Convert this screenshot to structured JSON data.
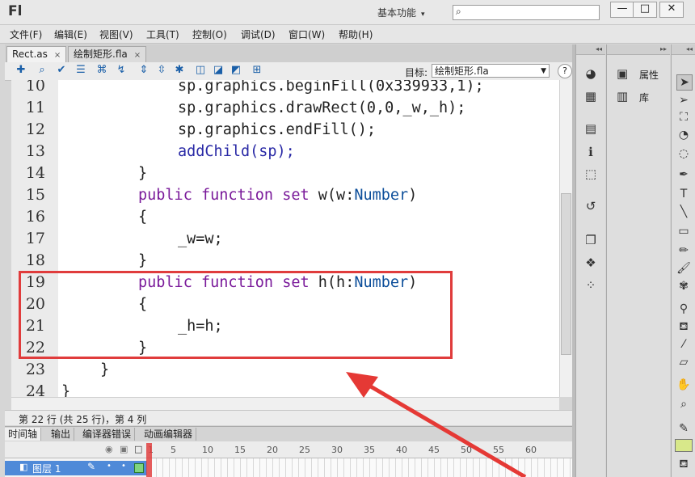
{
  "app": {
    "logo": "Fl",
    "workspace": "基本功能",
    "search_placeholder": ""
  },
  "window_controls": {
    "minimize": "—",
    "restore": "□",
    "close": "✕"
  },
  "menu": [
    "文件(F)",
    "编辑(E)",
    "视图(V)",
    "工具(T)",
    "控制(O)",
    "调试(D)",
    "窗口(W)",
    "帮助(H)"
  ],
  "tabs": [
    {
      "label": "Rect.as",
      "close": "×"
    },
    {
      "label": "绘制矩形.fla",
      "close": "×"
    }
  ],
  "toolbar": {
    "target_label": "目标:",
    "target_value": "绘制矩形.fla",
    "help": "?"
  },
  "editor": {
    "lines": [
      {
        "num": "10",
        "indent": 6
      },
      {
        "num": "11",
        "indent": 6
      },
      {
        "num": "12",
        "indent": 6
      },
      {
        "num": "13",
        "indent": 6
      },
      {
        "num": "14",
        "indent": 4
      },
      {
        "num": "15",
        "indent": 4
      },
      {
        "num": "16",
        "indent": 4
      },
      {
        "num": "17",
        "indent": 6
      },
      {
        "num": "18",
        "indent": 4
      },
      {
        "num": "19",
        "indent": 4
      },
      {
        "num": "20",
        "indent": 4
      },
      {
        "num": "21",
        "indent": 6
      },
      {
        "num": "22",
        "indent": 4
      },
      {
        "num": "23",
        "indent": 2
      },
      {
        "num": "24",
        "indent": 0
      }
    ],
    "code": {
      "l10": "sp.graphics.beginFill(0x339933,1);",
      "l11": "sp.graphics.drawRect(0,0,_w,_h);",
      "l12": "sp.graphics.endFill();",
      "l13": "addChild(sp);",
      "l14": "}",
      "l15_kw1": "public",
      "l15_kw2": "function",
      "l15_kw3": "set",
      "l15_name": "w(w:",
      "l15_type": "Number",
      "l15_end": ")",
      "l16": "{",
      "l17": "_w=w;",
      "l18": "}",
      "l19_kw1": "public",
      "l19_kw2": "function",
      "l19_kw3": "set",
      "l19_name": "h(h:",
      "l19_type": "Number",
      "l19_end": ")",
      "l20": "{",
      "l21": "_h=h;",
      "l22": "}",
      "l23": "}",
      "l24": "}"
    }
  },
  "status": "第 22 行 (共 25 行)，第 4 列",
  "timeline": {
    "tabs": [
      "时间轴",
      "输出",
      "编译器错误",
      "动画编辑器"
    ],
    "frame_numbers": [
      "1",
      "5",
      "10",
      "15",
      "20",
      "25",
      "30",
      "35",
      "40",
      "45",
      "50",
      "55",
      "60"
    ],
    "layer_name": "图层 1"
  },
  "right_panel": {
    "properties_label": "属性",
    "library_label": "库"
  }
}
